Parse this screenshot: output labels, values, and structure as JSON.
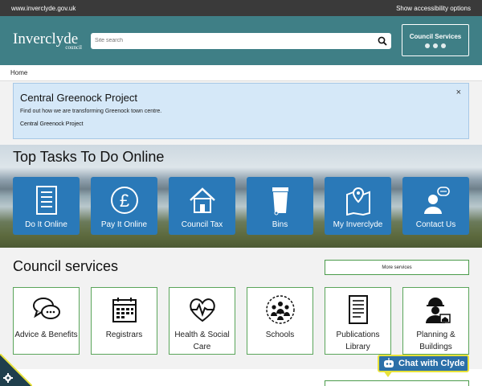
{
  "topbar": {
    "url": "www.inverclyde.gov.uk",
    "accessibility": "Show accessibility options"
  },
  "header": {
    "logo_main": "Inverclyde",
    "logo_sub": "council",
    "search_placeholder": "Site search",
    "council_services": "Council Services"
  },
  "breadcrumb": {
    "home": "Home"
  },
  "alert": {
    "title": "Central Greenock Project",
    "text": "Find out how we are transforming Greenock town centre.",
    "link": "Central Greenock Project",
    "close": "×"
  },
  "top_tasks": {
    "title": "Top Tasks To Do Online",
    "items": [
      {
        "label": "Do It Online",
        "icon": "form-icon"
      },
      {
        "label": "Pay It Online",
        "icon": "pound-icon"
      },
      {
        "label": "Council Tax",
        "icon": "house-icon"
      },
      {
        "label": "Bins",
        "icon": "bin-icon"
      },
      {
        "label": "My Inverclyde",
        "icon": "map-pin-icon"
      },
      {
        "label": "Contact Us",
        "icon": "contact-icon"
      }
    ]
  },
  "services": {
    "title": "Council services",
    "more": "More services",
    "items": [
      {
        "label": "Advice & Benefits",
        "icon": "chat-bubbles-icon"
      },
      {
        "label": "Registrars",
        "icon": "calendar-icon"
      },
      {
        "label": "Health & Social Care",
        "icon": "heartbeat-icon"
      },
      {
        "label": "Schools",
        "icon": "people-group-icon"
      },
      {
        "label": "Publications Library",
        "icon": "document-icon"
      },
      {
        "label": "Planning & Buildings",
        "icon": "builder-icon"
      }
    ]
  },
  "chat": {
    "label": "Chat with Clyde"
  },
  "colors": {
    "header": "#3f7f86",
    "task": "#2a79b8",
    "alert_bg": "#d5e8f8",
    "card_border": "#5aa55a",
    "chat_border": "#e8e23a"
  }
}
